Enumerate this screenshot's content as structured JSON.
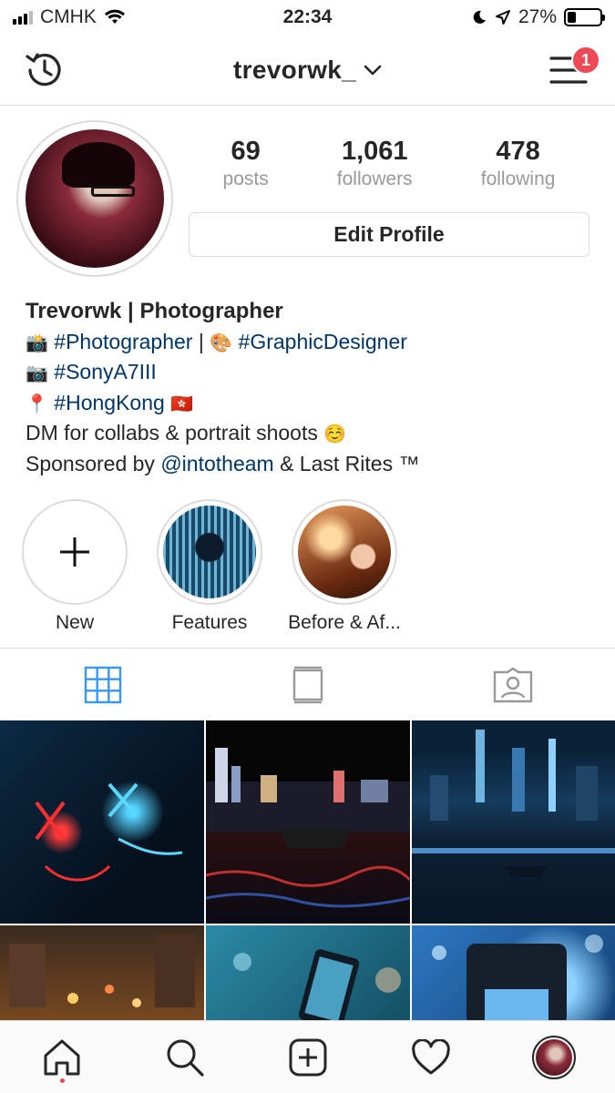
{
  "status_bar": {
    "carrier": "CMHK",
    "time": "22:34",
    "battery": "27%",
    "battery_level": 0.27
  },
  "header": {
    "username": "trevorwk_",
    "notification_count": "1",
    "icons": [
      "history-icon",
      "chevron-down-icon",
      "hamburger-menu-icon"
    ]
  },
  "profile": {
    "stats": [
      {
        "value": "69",
        "label": "posts"
      },
      {
        "value": "1,061",
        "label": "followers"
      },
      {
        "value": "478",
        "label": "following"
      }
    ],
    "edit_label": "Edit Profile",
    "bio": {
      "name": "Trevorwk | Photographer",
      "line1_emoji_a": "📸",
      "line1_tag_a": "#Photographer",
      "line1_sep": " | ",
      "line1_emoji_b": "🎨",
      "line1_tag_b": "#GraphicDesigner",
      "line2_emoji": "📷",
      "line2_tag": "#SonyA7III",
      "line3_emoji": "📍",
      "line3_tag": "#HongKong",
      "line3_flag": "🇭🇰",
      "line4": "DM for collabs & portrait shoots",
      "line4_emoji": "☺️",
      "line5_prefix": "Sponsored by ",
      "line5_mention": "@intotheam",
      "line5_suffix": " & Last Rites ™"
    }
  },
  "highlights": [
    {
      "label": "New"
    },
    {
      "label": "Features"
    },
    {
      "label": "Before & Af..."
    }
  ],
  "tabs": [
    "grid-icon",
    "feed-icon",
    "tagged-icon"
  ],
  "bottom_nav": [
    "home-icon",
    "search-icon",
    "add-post-icon",
    "heart-icon",
    "profile-avatar"
  ]
}
